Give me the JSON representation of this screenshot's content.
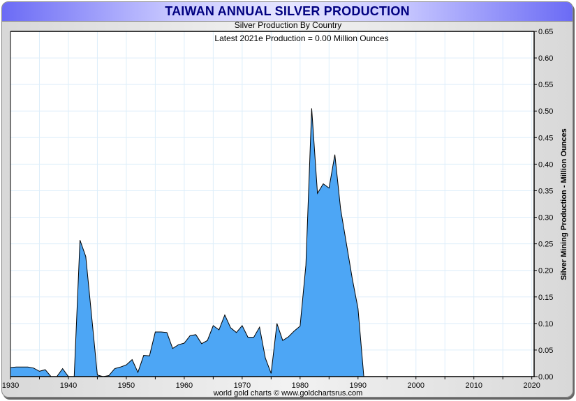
{
  "header": {
    "title": "TAIWAN ANNUAL SILVER PRODUCTION",
    "subtitle": "Silver Production By Country",
    "footer": "world gold charts © www.goldchartsrus.com"
  },
  "chart_data": {
    "type": "area",
    "title": "TAIWAN ANNUAL SILVER PRODUCTION",
    "subtitle": "Silver Production By Country",
    "annotation": "Latest 2021e Production = 0.00 Million Ounces",
    "ylabel": "Silver Mining Production - Million Ounces",
    "xlabel": "",
    "xlim": [
      1930,
      2020.4
    ],
    "ylim": [
      0,
      0.65
    ],
    "x_ticks": [
      "1930",
      "1940",
      "1950",
      "1960",
      "1970",
      "1980",
      "1990",
      "2000",
      "2010",
      "2020"
    ],
    "y_ticks": [
      "0.00",
      "0.05",
      "0.10",
      "0.15",
      "0.20",
      "0.25",
      "0.30",
      "0.35",
      "0.40",
      "0.45",
      "0.50",
      "0.55",
      "0.60",
      "0.65"
    ],
    "grid": true,
    "fill_color": "#4da6f5",
    "line_color": "#000000",
    "series": [
      {
        "name": "Taiwan",
        "x_start": 1930,
        "values": [
          0.017,
          0.018,
          0.018,
          0.018,
          0.016,
          0.01,
          0.013,
          0.0,
          0.0,
          0.015,
          0.0,
          0.0,
          0.257,
          0.226,
          0.115,
          0.003,
          0.0,
          0.002,
          0.015,
          0.018,
          0.022,
          0.032,
          0.008,
          0.04,
          0.039,
          0.084,
          0.084,
          0.083,
          0.053,
          0.06,
          0.063,
          0.077,
          0.079,
          0.062,
          0.068,
          0.096,
          0.088,
          0.116,
          0.092,
          0.083,
          0.096,
          0.074,
          0.074,
          0.093,
          0.035,
          0.006,
          0.1,
          0.068,
          0.075,
          0.086,
          0.095,
          0.21,
          0.505,
          0.345,
          0.363,
          0.355,
          0.418,
          0.315,
          0.25,
          0.185,
          0.128,
          0.0,
          0.0,
          0.0,
          0.0,
          0.0,
          0.0,
          0.0,
          0.0,
          0.0,
          0.0,
          0.0,
          0.0,
          0.0,
          0.0,
          0.0,
          0.0,
          0.0,
          0.0,
          0.0,
          0.0,
          0.0,
          0.0,
          0.0,
          0.0,
          0.0,
          0.0,
          0.0,
          0.0,
          0.0,
          0.0,
          0.0
        ]
      }
    ]
  }
}
